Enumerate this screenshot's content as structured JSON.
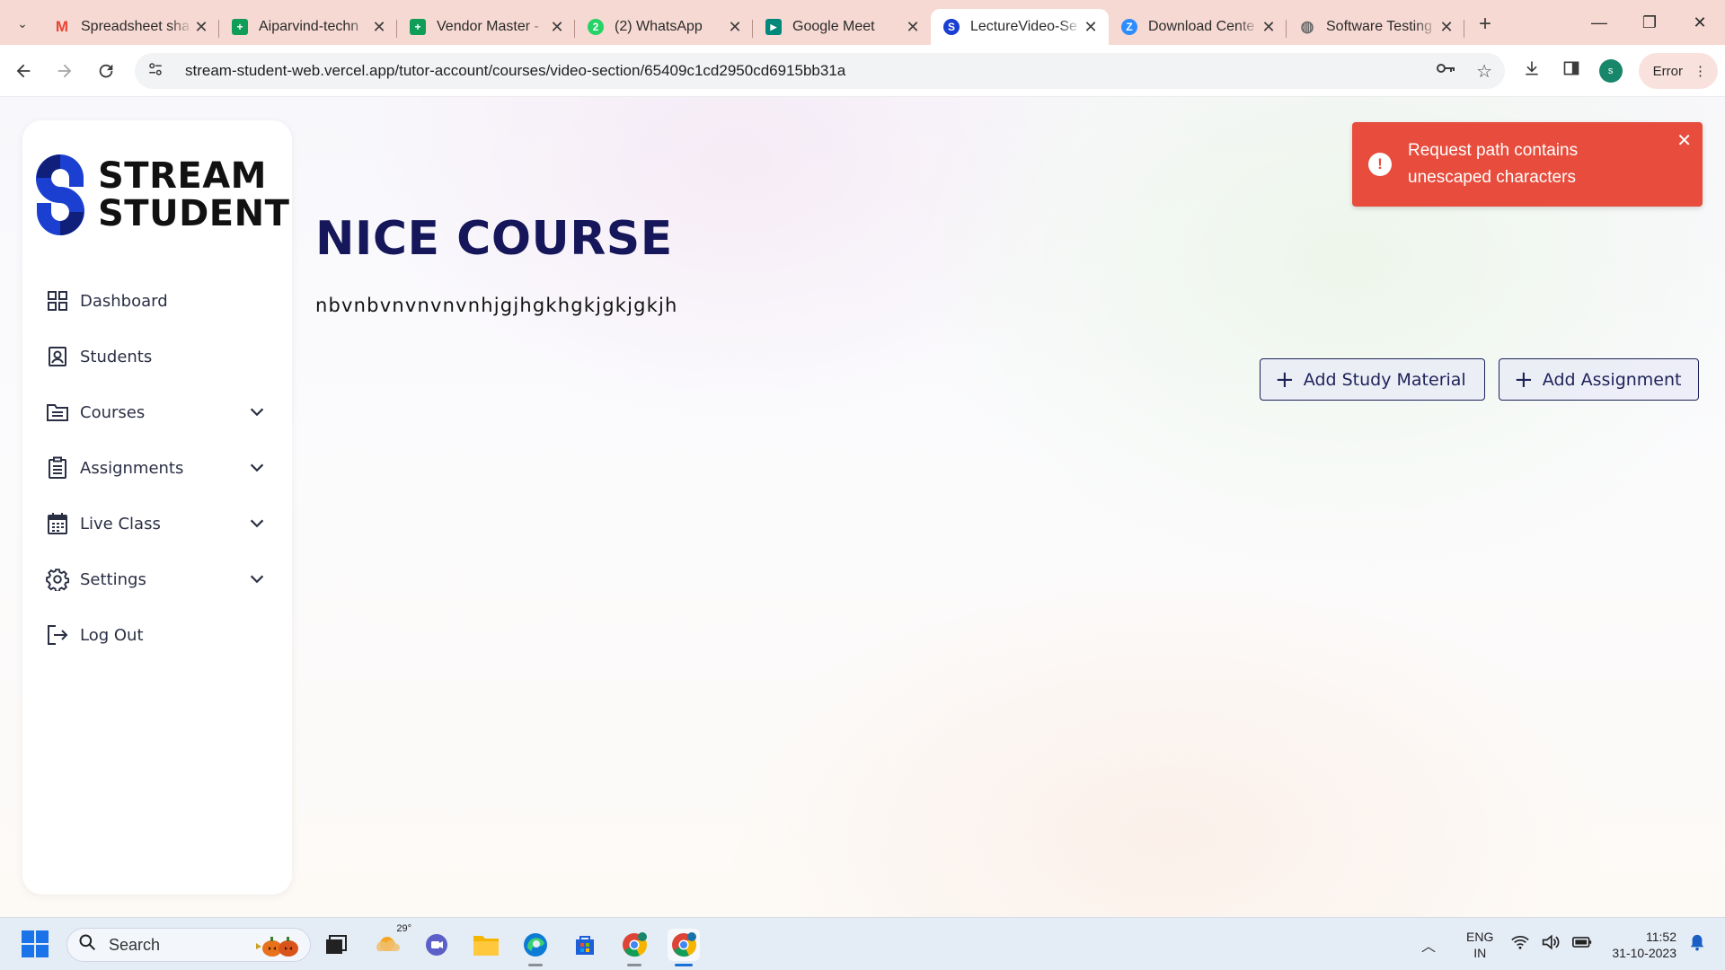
{
  "browser": {
    "tabs": [
      {
        "title": "Spreadsheet sha",
        "favicon": "gmail-icon",
        "color": "#ea4335",
        "glyph": "M"
      },
      {
        "title": "Aiparvind-techn",
        "favicon": "sheets-icon",
        "color": "#0f9d58",
        "glyph": "+"
      },
      {
        "title": "Vendor Master -",
        "favicon": "sheets-icon",
        "color": "#0f9d58",
        "glyph": "+"
      },
      {
        "title": "(2) WhatsApp",
        "favicon": "whatsapp-icon",
        "color": "#25d366",
        "glyph": "2"
      },
      {
        "title": "Google Meet",
        "favicon": "meet-icon",
        "color": "#00897b",
        "glyph": "▶"
      },
      {
        "title": "LectureVideo-Se",
        "favicon": "stream-student-icon",
        "color": "#1a3fd1",
        "glyph": "S",
        "active": true
      },
      {
        "title": "Download Cente",
        "favicon": "zoom-icon",
        "color": "#2d8cff",
        "glyph": "Z"
      },
      {
        "title": "Software Testing",
        "favicon": "globe-icon",
        "color": "#6b6b6b",
        "glyph": "◍"
      }
    ],
    "url": "stream-student-web.vercel.app/tutor-account/courses/video-section/65409c1cd2950cd6915bb31a",
    "profile_initial": "s",
    "error_chip": "Error"
  },
  "sidebar": {
    "logo_line1": "STREAM",
    "logo_line2": "STUDENT",
    "items": [
      {
        "label": "Dashboard",
        "icon": "dashboard-grid-icon",
        "expandable": false
      },
      {
        "label": "Students",
        "icon": "student-id-icon",
        "expandable": false
      },
      {
        "label": "Courses",
        "icon": "folder-icon",
        "expandable": true
      },
      {
        "label": "Assignments",
        "icon": "clipboard-icon",
        "expandable": true
      },
      {
        "label": "Live Class",
        "icon": "calendar-icon",
        "expandable": true
      },
      {
        "label": "Settings",
        "icon": "gear-icon",
        "expandable": true
      },
      {
        "label": "Log Out",
        "icon": "logout-icon",
        "expandable": false
      }
    ]
  },
  "course": {
    "title": "NICE COURSE",
    "description": "nbvnbvnvnvnvnhjgjhgkhgkjgkjgkjh"
  },
  "actions": {
    "add_study_material": "Add Study Material",
    "add_assignment": "Add Assignment"
  },
  "toast": {
    "message": "Request path contains unescaped characters",
    "type": "error",
    "color": "#e74c3c"
  },
  "taskbar": {
    "search_placeholder": "Search",
    "weather_temp": "29°",
    "lang_line1": "ENG",
    "lang_line2": "IN",
    "time": "11:52",
    "date": "31-10-2023"
  },
  "colors": {
    "brand": "#16165a",
    "accent": "#1a3fd1",
    "tabstrip": "#f6d9d2"
  }
}
